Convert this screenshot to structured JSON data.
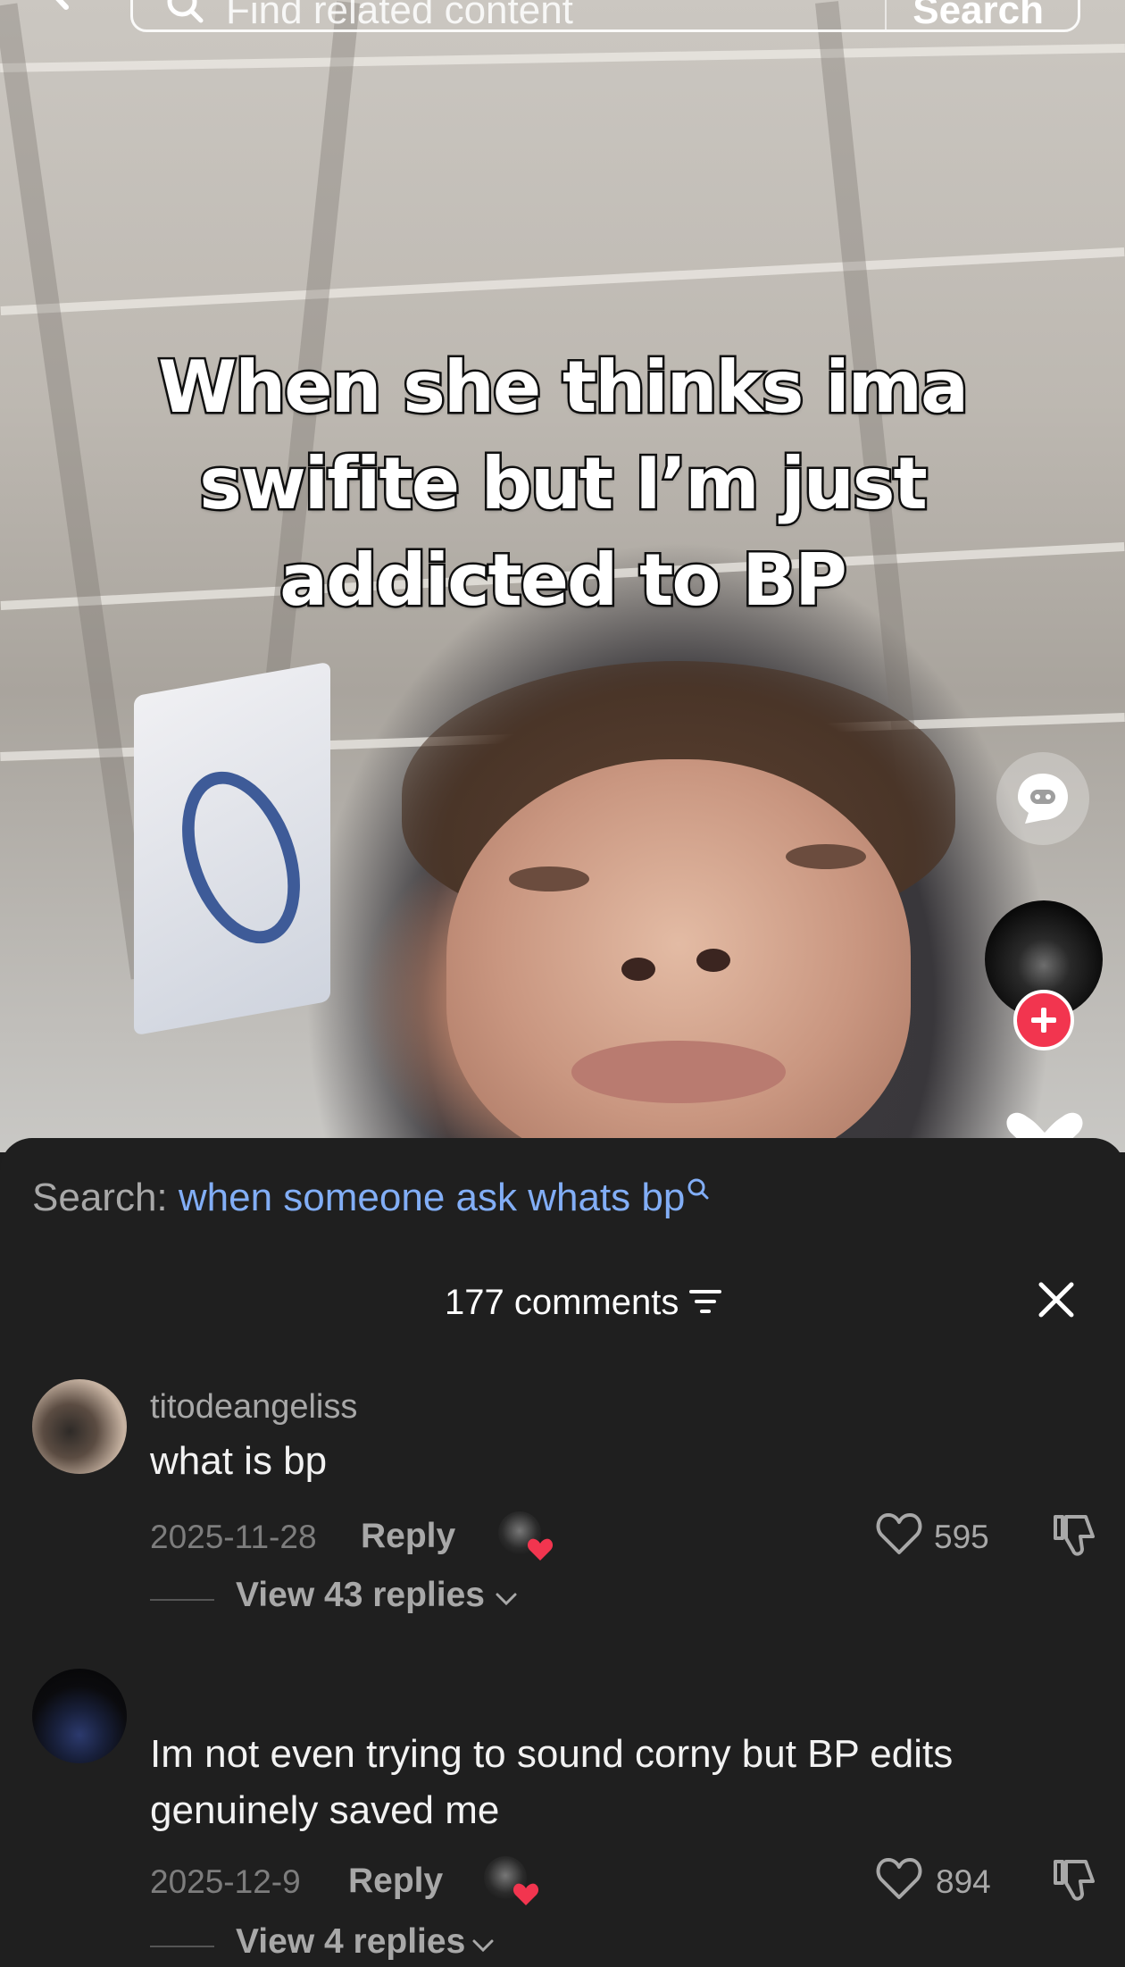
{
  "top_bar": {
    "search_placeholder": "Find related content",
    "search_button": "Search"
  },
  "video": {
    "caption": "When she thinks ima\nswifite but I’m just\naddicted to BP"
  },
  "comments_sheet": {
    "search_label": "Search:",
    "search_query": "when someone ask whats bp",
    "comment_count": "177 comments",
    "comments": [
      {
        "username": "titodeangeliss",
        "text": "what is bp",
        "date": "2025-11-28",
        "reply_label": "Reply",
        "likes": "595",
        "view_replies": "View 43 replies"
      },
      {
        "username": "",
        "text": "Im not even trying to sound corny but BP edits genuinely saved me",
        "date": "2025-12-9",
        "reply_label": "Reply",
        "likes": "894",
        "view_replies": "View 4 replies"
      }
    ]
  },
  "colors": {
    "sheet_bg": "#1f1f1f",
    "search_query": "#82aef6",
    "follow_button": "#f2354f",
    "liked_heart": "#f2354f"
  },
  "icons": [
    "back-icon",
    "search-icon",
    "ai-chat-icon",
    "plus-icon",
    "heart-icon",
    "filter-icon",
    "close-icon",
    "dislike-icon",
    "chevron-down-icon"
  ]
}
